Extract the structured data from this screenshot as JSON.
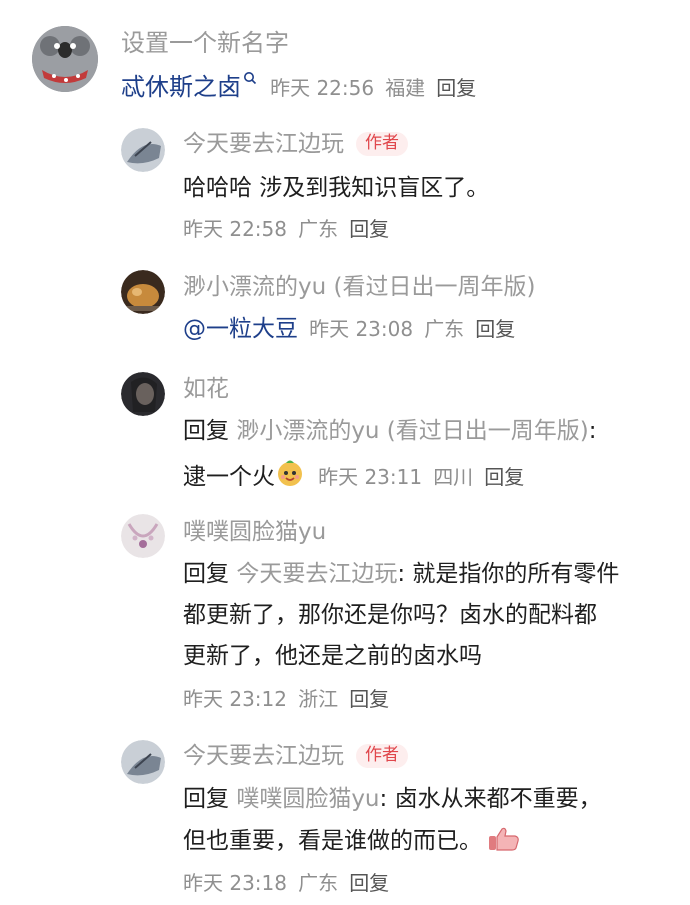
{
  "comment": {
    "user": "设置一个新名字",
    "text": "忒休斯之卤",
    "time": "昨天 22:56",
    "location": "福建",
    "reply_label": "回复"
  },
  "replies": [
    {
      "user": "今天要去江边玩",
      "badge": "作者",
      "text": "哈哈哈 涉及到我知识盲区了。",
      "time": "昨天 22:58",
      "location": "广东",
      "reply_label": "回复"
    },
    {
      "user": "渺小漂流的yu (看过日出一周年版)",
      "mention": "@一粒大豆",
      "time": "昨天 23:08",
      "location": "广东",
      "reply_label": "回复"
    },
    {
      "user": "如花",
      "prefix": "回复",
      "target": "渺小漂流的yu (看过日出一周年版)",
      "colon": ":",
      "text": "逮一个火",
      "emoji": "cute-face-emoji",
      "time": "昨天 23:11",
      "location": "四川",
      "reply_label": "回复"
    },
    {
      "user": "噗噗圆脸猫yu",
      "prefix": "回复",
      "target": "今天要去江边玩",
      "line1": ": 就是指你的所有零件",
      "line2": "都更新了，那你还是你吗？卤水的配料都",
      "line3": "更新了，他还是之前的卤水吗",
      "time": "昨天 23:12",
      "location": "浙江",
      "reply_label": "回复"
    },
    {
      "user": "今天要去江边玩",
      "badge": "作者",
      "prefix": "回复",
      "target": "噗噗圆脸猫yu",
      "line1": ": 卤水从来都不重要，",
      "line2": "但也重要，看是谁做的而已。",
      "emoji": "thumbs-up-emoji",
      "time": "昨天 23:18",
      "location": "广东",
      "reply_label": "回复"
    }
  ],
  "colors": {
    "author_badge_bg": "#fdeeee",
    "author_badge_text": "#e0474c",
    "username": "#9a9a9a",
    "mention": "#1e3f8a"
  }
}
